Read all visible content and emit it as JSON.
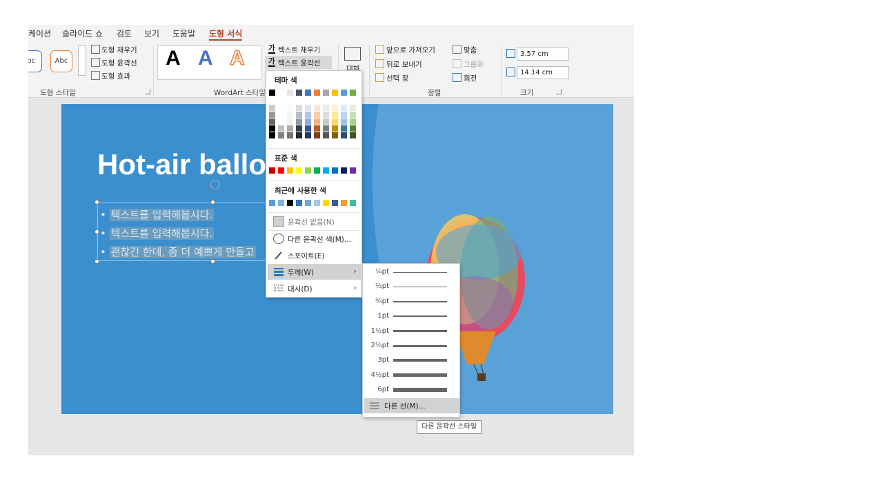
{
  "tabs": [
    "케이션",
    "슬라이드 쇼",
    "검토",
    "보기",
    "도움말",
    "도형 서식"
  ],
  "ribbon": {
    "shape_style_previews": [
      "bc",
      "Abc"
    ],
    "shape_fill": "도형 채우기",
    "shape_outline": "도형 윤곽선",
    "shape_effect": "도형 효과",
    "group_shape_style": "도형 스타일",
    "wordart_letters": [
      "A",
      "A",
      "A"
    ],
    "text_fill": "텍스트 채우기",
    "text_outline": "텍스트 윤곽선",
    "text_outline_icon": "가",
    "group_wordart": "WordArt 스타일",
    "alt_text": "대체",
    "bring_forward": "앞으로 가져오기",
    "send_backward": "뒤로 보내기",
    "selection_pane": "선택 창",
    "align": "맞춤",
    "group": "그룹화",
    "rotate": "회전",
    "group_arrange": "정렬",
    "height": "3.57 cm",
    "width": "14.14 cm",
    "group_size": "크기"
  },
  "slide": {
    "title": "Hot-air ballo",
    "bullets": [
      "텍스트를 입력해봅시다.",
      "텍스트를 입력해봅시다.",
      "괜찮긴 한데, 좀 더 예쁘게 만들고"
    ]
  },
  "outline_menu": {
    "theme_colors_label": "테마 색",
    "standard_colors_label": "표준 색",
    "recent_colors_label": "최근에 사용한 색",
    "no_outline": "윤곽선 없음(N)",
    "more_colors": "다른 윤곽선 색(M)...",
    "eyedropper": "스포이트(E)",
    "weight": "두께(W)",
    "dashes": "대시(D)",
    "theme_top_row": [
      "#000000",
      "#ffffff",
      "#e7e6e6",
      "#44546a",
      "#4472c4",
      "#ed7d31",
      "#a5a5a5",
      "#ffc000",
      "#5b9bd5",
      "#70ad47"
    ],
    "standard_colors": [
      "#c00000",
      "#ff0000",
      "#ffc000",
      "#ffff00",
      "#92d050",
      "#00b050",
      "#00b0f0",
      "#0070c0",
      "#002060",
      "#7030a0"
    ],
    "recent_colors": [
      "#5b9bd5",
      "#7fb1dc",
      "#000000",
      "#2e75b6",
      "#70a5d6",
      "#a5c6e5",
      "#ffd700",
      "#3b5998",
      "#f0a030",
      "#40c0a0"
    ]
  },
  "weight_menu": {
    "options": [
      "¼pt",
      "½pt",
      "¾pt",
      "1pt",
      "1½pt",
      "2¼pt",
      "3pt",
      "4½pt",
      "6pt"
    ],
    "more_lines": "다른 선(M)..."
  },
  "tooltip": "다른 윤곽선 스타일"
}
